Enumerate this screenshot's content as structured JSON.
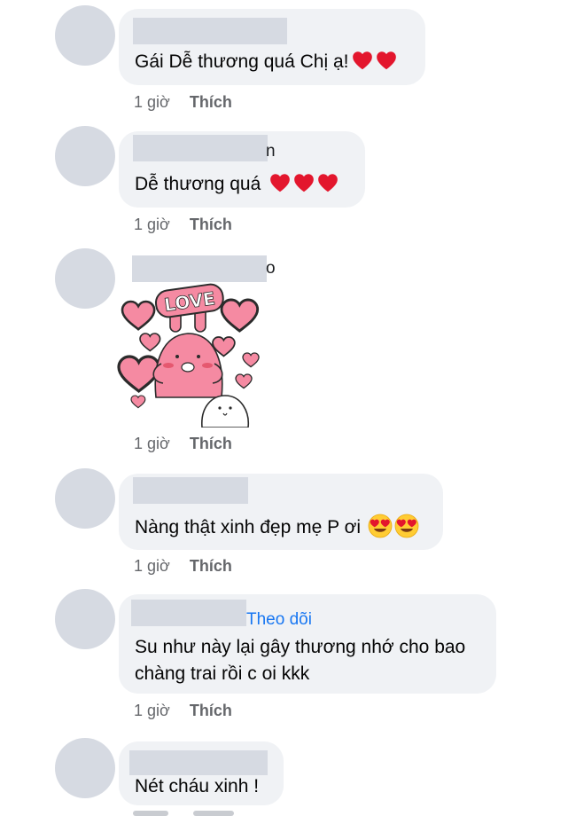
{
  "comments": [
    {
      "name_tail": "",
      "text": "Gái Dễ thương quá Chị ạ!",
      "time": "1 giờ",
      "like": "Thích",
      "hearts": 2
    },
    {
      "name_tail": "n",
      "text": "Dễ thương quá",
      "time": "1 giờ",
      "like": "Thích",
      "hearts": 3
    },
    {
      "name_tail": "o",
      "sticker_text": "LOVE",
      "time": "1 giờ",
      "like": "Thích"
    },
    {
      "text": "Nàng thật xinh đẹp mẹ P ơi",
      "time": "1 giờ",
      "like": "Thích",
      "emoji": "heart-eyes"
    },
    {
      "follow": "Theo dõi",
      "text_line1": "Su như này lại gây thương nhớ cho bao",
      "text_line2": "chàng trai rồi c oi kkk",
      "time": "1 giờ",
      "like": "Thích"
    },
    {
      "text": "Nét cháu xinh !"
    }
  ],
  "icons": {
    "heart": "red-heart-icon",
    "heart_eyes": "heart-eyes-emoji-icon"
  },
  "colors": {
    "bubble": "#f0f2f5",
    "avatar_placeholder": "#d6dae2",
    "heart": "#e3162d",
    "link": "#1877f2",
    "meta": "#65676b"
  }
}
